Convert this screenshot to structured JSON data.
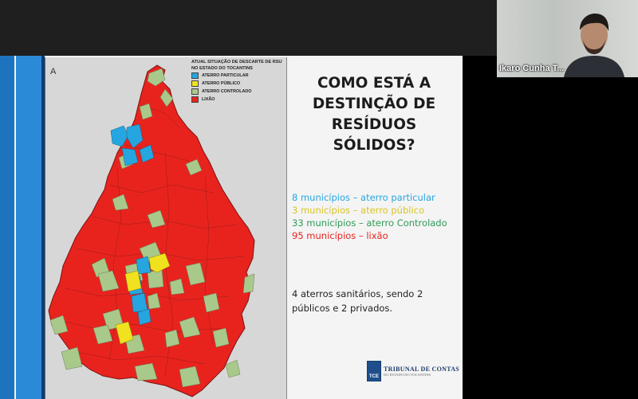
{
  "slide": {
    "map": {
      "north_marker": "A",
      "legend_title": "ATUAL SITUAÇÃO DE DESCARTE DE RSU NO ESTADO DO TOCANTINS",
      "legend": [
        {
          "label": "ATERRO PARTICULAR",
          "color": "#26a6e0"
        },
        {
          "label": "ATERRO PÚBLICO",
          "color": "#f0e21e"
        },
        {
          "label": "ATERRO CONTROLADO",
          "color": "#a9c98a"
        },
        {
          "label": "LIXÃO",
          "color": "#e8231e"
        }
      ]
    },
    "question_lines": [
      "COMO ESTÁ A",
      "DESTINÇÃO DE",
      "RESÍDUOS",
      "SÓLIDOS?"
    ],
    "stats": [
      {
        "text": "8 municípios – aterro particular",
        "color": "#26a6e0"
      },
      {
        "text": "3 municípios – aterro público",
        "color": "#d8c524"
      },
      {
        "text": "33 municípios – aterro Controlado",
        "color": "#2e9a57"
      },
      {
        "text": "95 municípios – lixão",
        "color": "#e8231e"
      }
    ],
    "info_line1": "4 aterros sanitários, sendo 2",
    "info_line2": "públicos e 2 privados.",
    "logo": {
      "mark": "TCE",
      "name": "TRIBUNAL DE CONTAS",
      "subtitle": "DO ESTADO DO TOCANTINS"
    }
  },
  "video": {
    "participant_name": "Ikaro Cunha T..."
  }
}
